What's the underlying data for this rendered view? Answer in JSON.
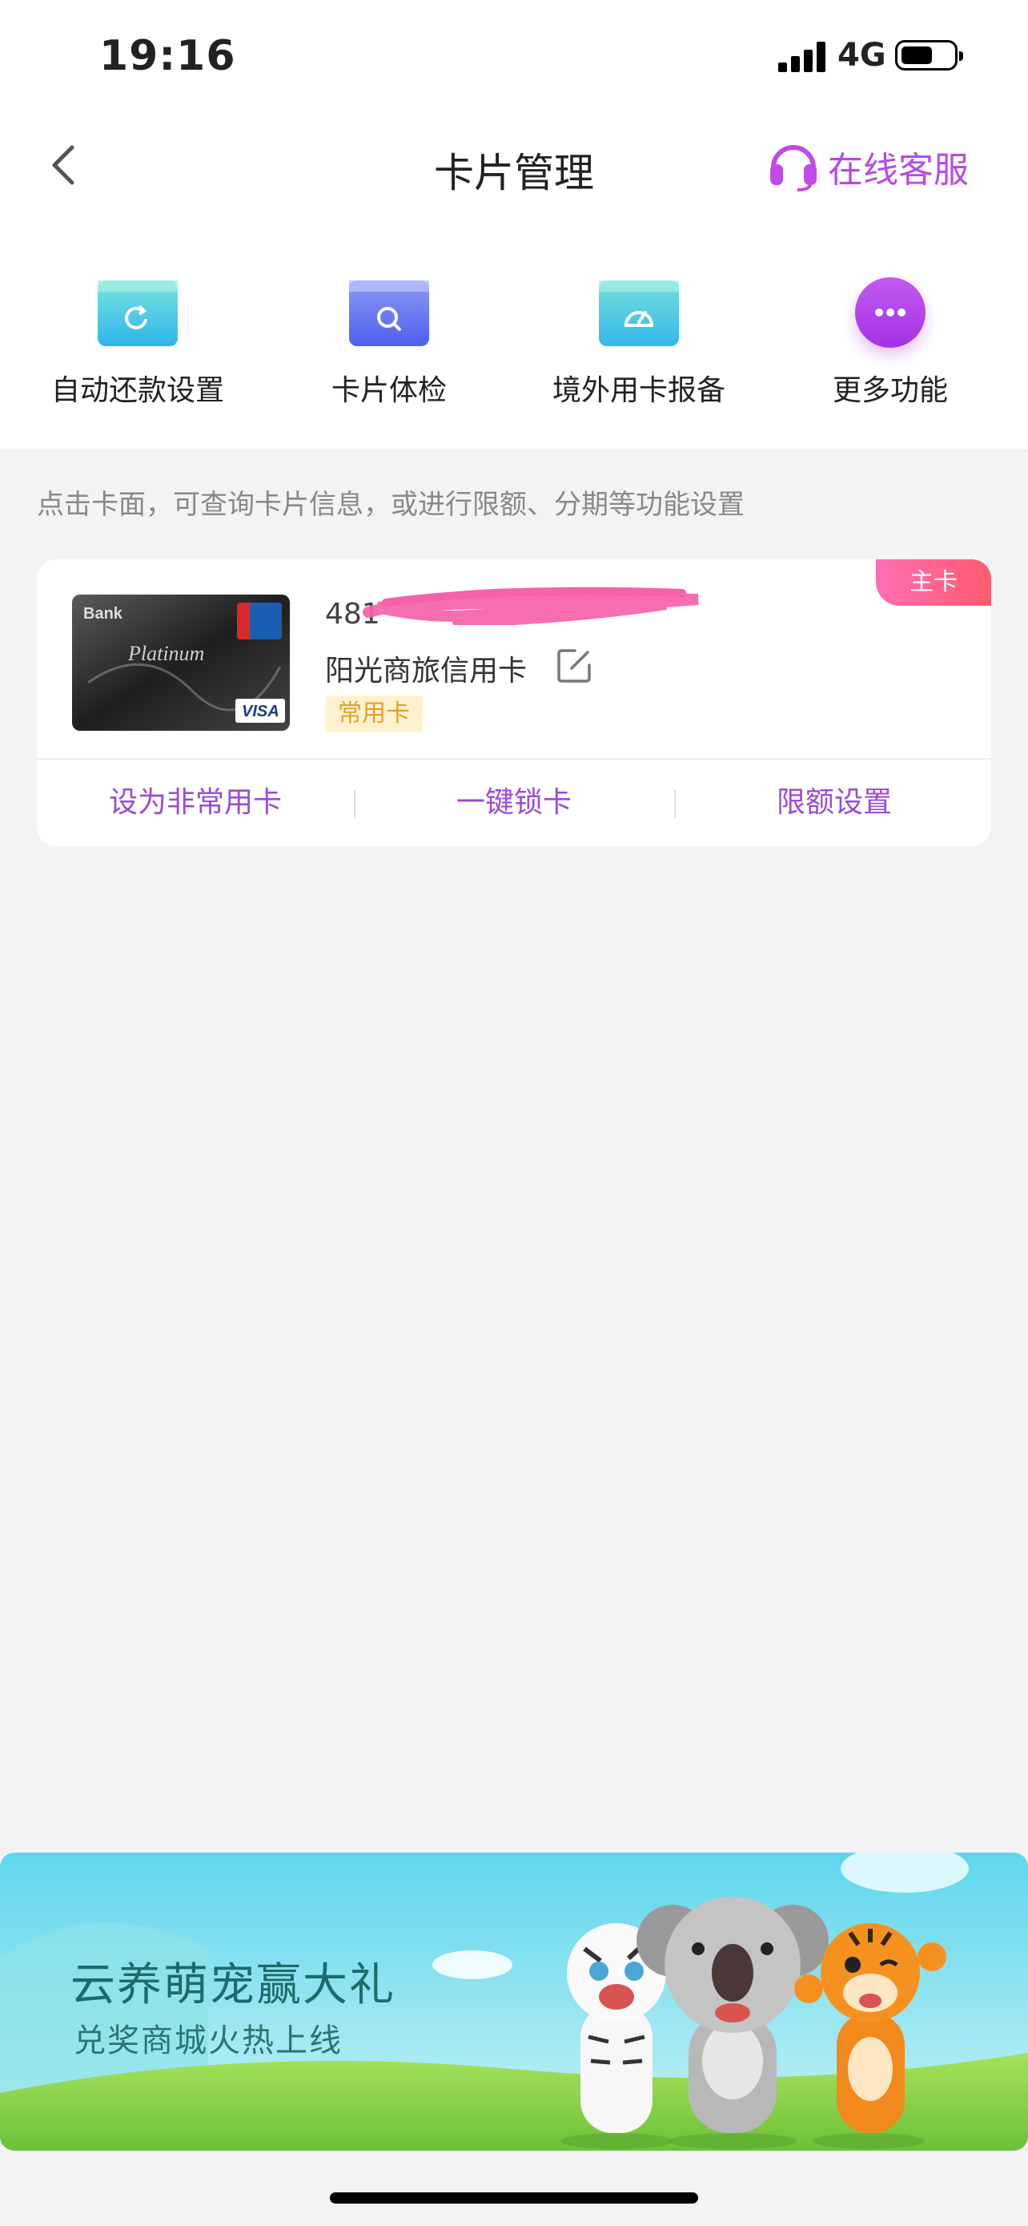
{
  "status_bar": {
    "time": "19:16",
    "network": "4G"
  },
  "nav": {
    "title": "卡片管理",
    "service_label": "在线客服"
  },
  "quick_actions": [
    {
      "label": "自动还款设置",
      "icon": "auto-repay-icon",
      "color": "#38c6e6"
    },
    {
      "label": "卡片体检",
      "icon": "card-checkup-icon",
      "color": "#5a6ff0"
    },
    {
      "label": "境外用卡报备",
      "icon": "overseas-report-icon",
      "color": "#3fc0e8"
    },
    {
      "label": "更多功能",
      "icon": "more-icon",
      "color": "#b542ea"
    }
  ],
  "hint": "点击卡面，可查询卡片信息，或进行限额、分期等功能设置",
  "card": {
    "badge": "主卡",
    "number_prefix": "481",
    "name": "阳光商旅信用卡",
    "tag": "常用卡",
    "face_text": {
      "bank": "Bank",
      "series": "Platinum",
      "network": "VISA"
    },
    "actions": [
      "设为非常用卡",
      "一键锁卡",
      "限额设置"
    ]
  },
  "banner": {
    "title": "云养萌宠赢大礼",
    "subtitle": "兑奖商城火热上线"
  },
  "colors": {
    "accent": "#9a4ad8",
    "service": "#b54be5",
    "background": "#f3f3f6"
  }
}
